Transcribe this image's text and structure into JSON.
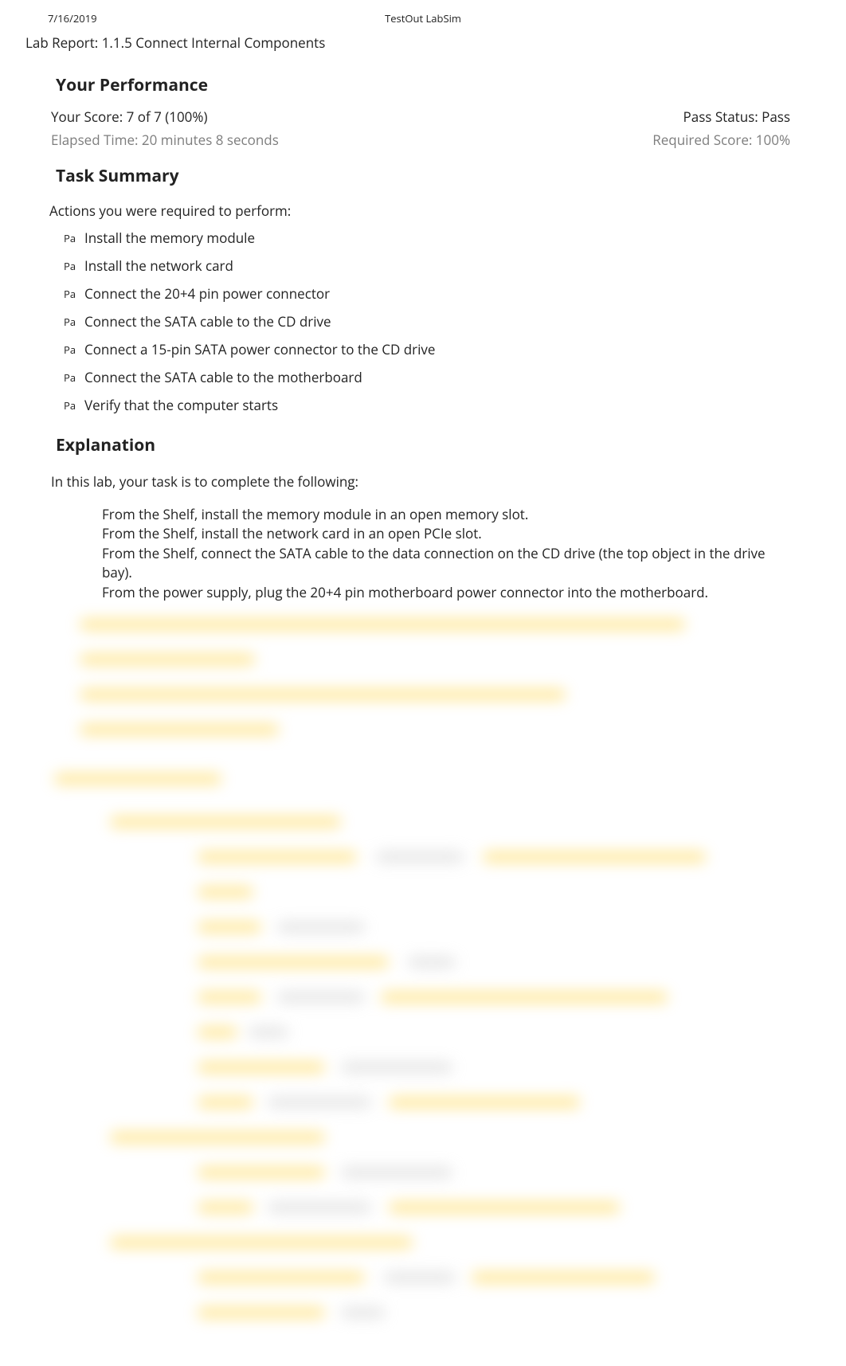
{
  "header": {
    "date": "7/16/2019",
    "app_title": "TestOut LabSim"
  },
  "lab_title": "Lab Report: 1.1.5 Connect Internal Components",
  "performance": {
    "heading": "Your Performance",
    "score_line": "Your Score: 7 of 7 (100%)",
    "pass_status": "Pass Status: Pass",
    "elapsed": "Elapsed Time: 20 minutes 8 seconds",
    "required": "Required Score: 100%"
  },
  "task_summary": {
    "heading": "Task Summary",
    "actions_label": "Actions you were required to perform:",
    "pa_label": "Pa",
    "items": [
      "Install the memory module",
      "Install the network card",
      "Connect the 20+4 pin power connector",
      "Connect the SATA cable to the CD drive",
      "Connect a 15-pin SATA power connector to the CD drive",
      "Connect the SATA cable to the motherboard",
      "Verify that the computer starts"
    ]
  },
  "explanation": {
    "heading": "Explanation",
    "intro": "In this lab, your task is to complete the following:",
    "bullets": [
      "From the Shelf, install the memory module in an open memory slot.",
      "From the Shelf, install the network card in an open PCIe slot.",
      "From the Shelf, connect the SATA cable to the data connection on the CD drive (the top object in the drive bay).",
      "From the power supply, plug the 20+4 pin motherboard power connector into the motherboard."
    ]
  }
}
